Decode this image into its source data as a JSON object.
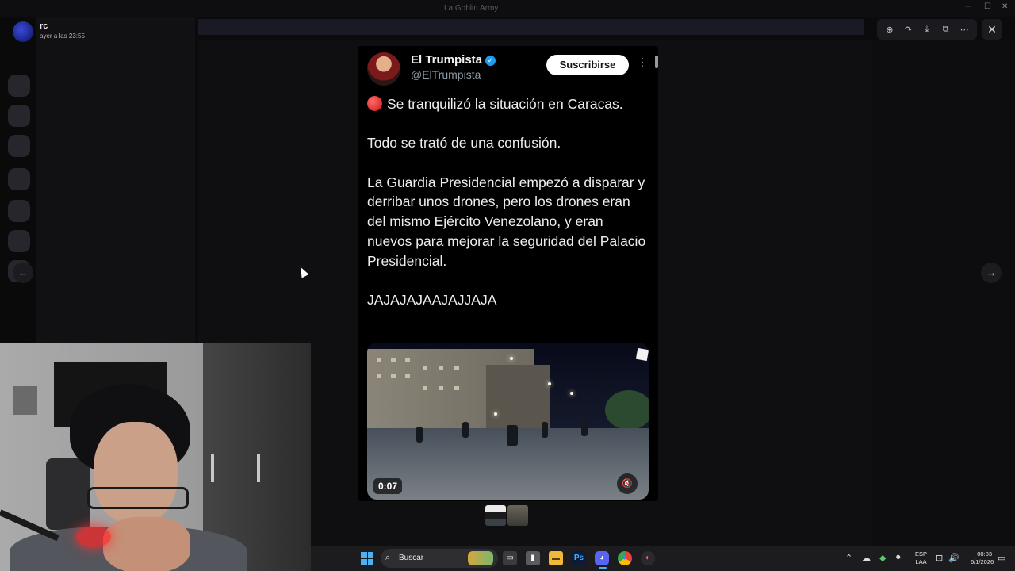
{
  "window": {
    "title": "La Goblin Army"
  },
  "banner": {
    "text": ""
  },
  "uploader": {
    "name": "rc",
    "timestamp": "ayer a las 23:55"
  },
  "viewer_tools": [
    "zoom-in-icon",
    "forward-icon",
    "download-icon",
    "open-external-icon",
    "more-icon"
  ],
  "tweet": {
    "author_name": "El Trumpista",
    "author_handle": "@ElTrumpista",
    "subscribe_label": "Suscribirse",
    "text": {
      "line1": "Se tranquilizó la situación en Caracas.",
      "line2": "Todo se trató de una confusión.",
      "line3": "La Guardia Presidencial empezó a disparar y derribar unos drones, pero los drones eran del mismo Ejército Venezolano, y eran nuevos para mejorar la seguridad del Palacio Presidencial.",
      "line4": "JAJAJAJAAJAJJAJA"
    },
    "video": {
      "duration": "0:07",
      "muted": true
    }
  },
  "taskbar": {
    "search_placeholder": "Buscar",
    "language": "ESP",
    "layout": "LAA",
    "time": "00:03",
    "date": "6/1/2026",
    "accent_color": "#4ab1f5"
  }
}
